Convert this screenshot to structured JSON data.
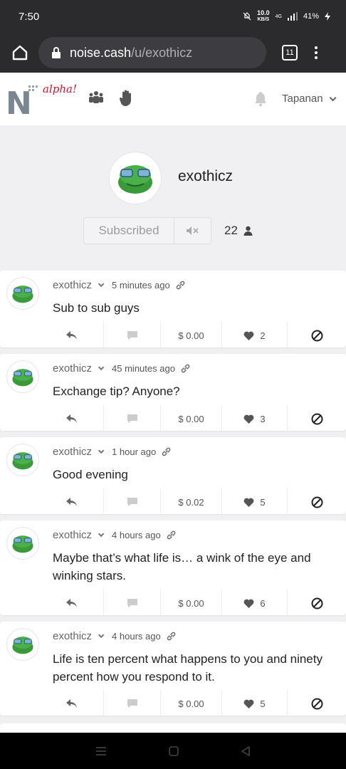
{
  "status": {
    "time": "7:50",
    "net_speed_value": "10.0",
    "net_speed_unit": "KB/S",
    "signal": "4G",
    "battery": "41%"
  },
  "browser": {
    "url_host": "noise.cash",
    "url_path": "/u/exothicz",
    "tab_count": "11"
  },
  "header": {
    "alpha_label": "alpha!",
    "language": "Tapanan"
  },
  "profile": {
    "username": "exothicz",
    "subscribe_label": "Subscribed",
    "subscriber_count": "22"
  },
  "posts": [
    {
      "user": "exothicz",
      "time": "5 minutes ago",
      "text": "Sub to sub guys",
      "tips": "$ 0.00",
      "likes": "2"
    },
    {
      "user": "exothicz",
      "time": "45 minutes ago",
      "text": "Exchange tip? Anyone?",
      "tips": "$ 0.00",
      "likes": "3"
    },
    {
      "user": "exothicz",
      "time": "1 hour ago",
      "text": "Good evening",
      "tips": "$ 0.02",
      "likes": "5"
    },
    {
      "user": "exothicz",
      "time": "4 hours ago",
      "text": "Maybe that’s what life is… a wink of the eye and winking stars.",
      "tips": "$ 0.00",
      "likes": "6"
    },
    {
      "user": "exothicz",
      "time": "4 hours ago",
      "text": "Life is ten percent what happens to you and ninety percent how you respond to it.",
      "tips": "$ 0.00",
      "likes": "5"
    }
  ],
  "colors": {
    "accent_red": "#d0152b",
    "avatar_green": "#3a9a3a",
    "page_bg": "#f0f0f2"
  },
  "icons": [
    "home-icon",
    "lock-icon",
    "tabs-icon",
    "menu-icon",
    "community-icon",
    "hand-icon",
    "bell-icon",
    "mute-icon",
    "person-icon",
    "link-icon",
    "reply-icon",
    "comment-icon",
    "heart-icon",
    "block-icon"
  ]
}
